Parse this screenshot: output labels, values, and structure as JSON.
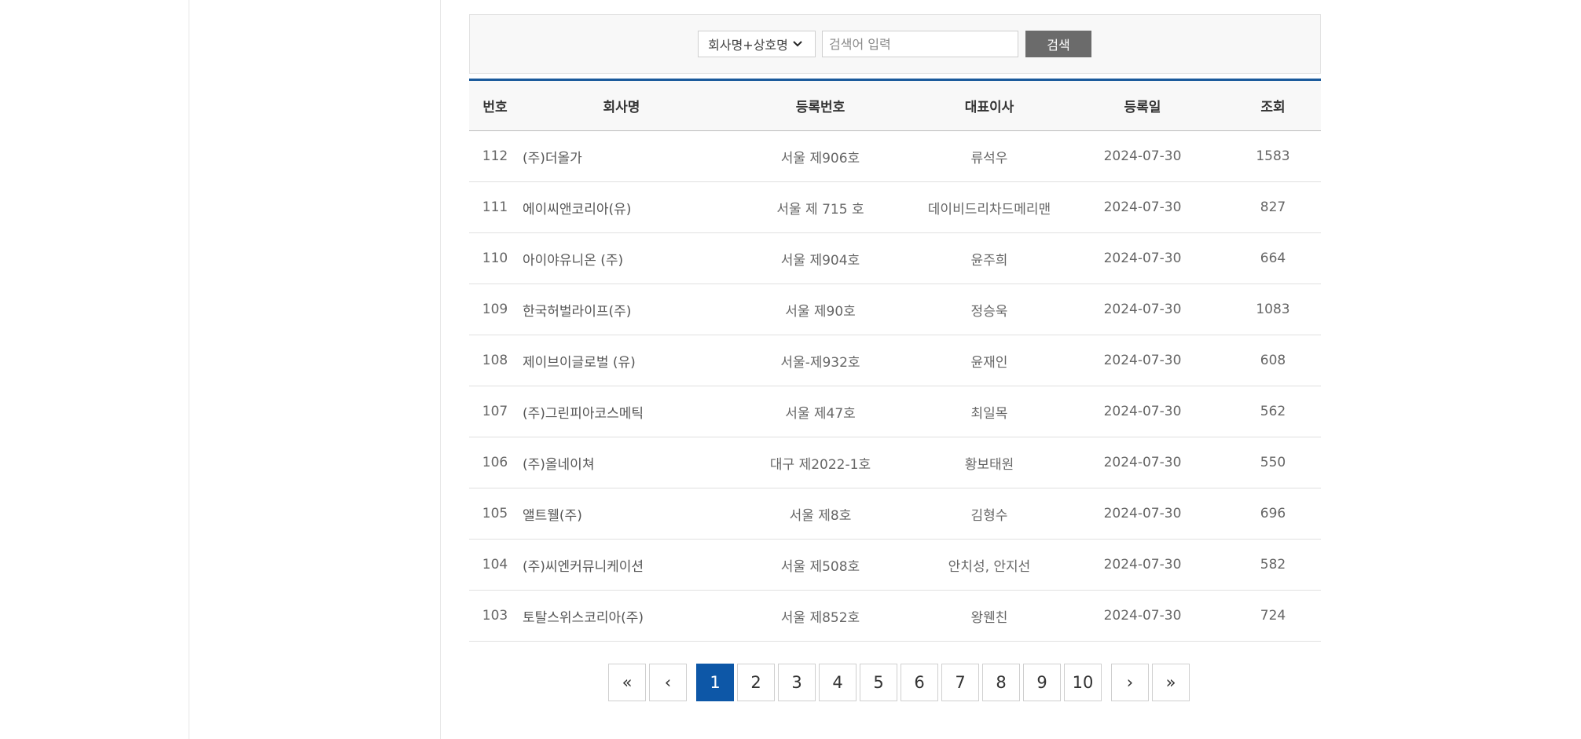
{
  "search": {
    "select_value": "회사명+상호명",
    "input_placeholder": "검색어 입력",
    "button_label": "검색"
  },
  "table": {
    "headers": [
      "번호",
      "회사명",
      "등록번호",
      "대표이사",
      "등록일",
      "조회"
    ],
    "rows": [
      [
        "112",
        "(주)더올가",
        "서울 제906호",
        "류석우",
        "2024-07-30",
        "1583"
      ],
      [
        "111",
        "에이씨앤코리아(유)",
        "서울 제 715 호",
        "데이비드리차드메리맨",
        "2024-07-30",
        "827"
      ],
      [
        "110",
        "아이야유니온 (주)",
        "서울 제904호",
        "윤주희",
        "2024-07-30",
        "664"
      ],
      [
        "109",
        "한국허벌라이프(주)",
        "서울 제90호",
        "정승욱",
        "2024-07-30",
        "1083"
      ],
      [
        "108",
        "제이브이글로벌 (유)",
        "서울-제932호",
        "윤재인",
        "2024-07-30",
        "608"
      ],
      [
        "107",
        "(주)그린피아코스메틱",
        "서울 제47호",
        "최일목",
        "2024-07-30",
        "562"
      ],
      [
        "106",
        "(주)올네이쳐",
        "대구 제2022-1호",
        "황보태원",
        "2024-07-30",
        "550"
      ],
      [
        "105",
        "앨트웰(주)",
        "서울 제8호",
        "김형수",
        "2024-07-30",
        "696"
      ],
      [
        "104",
        "(주)씨엔커뮤니케이션",
        "서울 제508호",
        "안치성, 안지선",
        "2024-07-30",
        "582"
      ],
      [
        "103",
        "토탈스위스코리아(주)",
        "서울 제852호",
        "왕웬친",
        "2024-07-30",
        "724"
      ]
    ]
  },
  "pagination": {
    "first": "«",
    "prev": "‹",
    "pages": [
      "1",
      "2",
      "3",
      "4",
      "5",
      "6",
      "7",
      "8",
      "9",
      "10"
    ],
    "active_page": "1",
    "next": "›",
    "last": "»"
  },
  "colors": {
    "accent": "#0d57a7",
    "header_border": "#1b5a9c",
    "search_button": "#6b6b6b"
  }
}
